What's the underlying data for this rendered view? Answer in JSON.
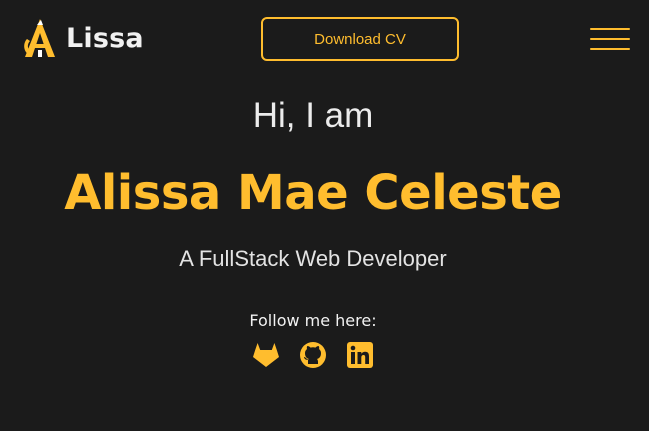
{
  "header": {
    "brand_name": "Lissa",
    "download_label": "Download CV"
  },
  "hero": {
    "greeting": "Hi, I am",
    "name": "Alissa Mae Celeste",
    "tagline": "A FullStack Web Developer"
  },
  "social": {
    "label": "Follow me here:",
    "icons": [
      "gitlab-icon",
      "github-icon",
      "linkedin-icon"
    ]
  },
  "colors": {
    "accent": "#ffbd2e",
    "background": "#1b1b1b",
    "text": "#ececec"
  }
}
